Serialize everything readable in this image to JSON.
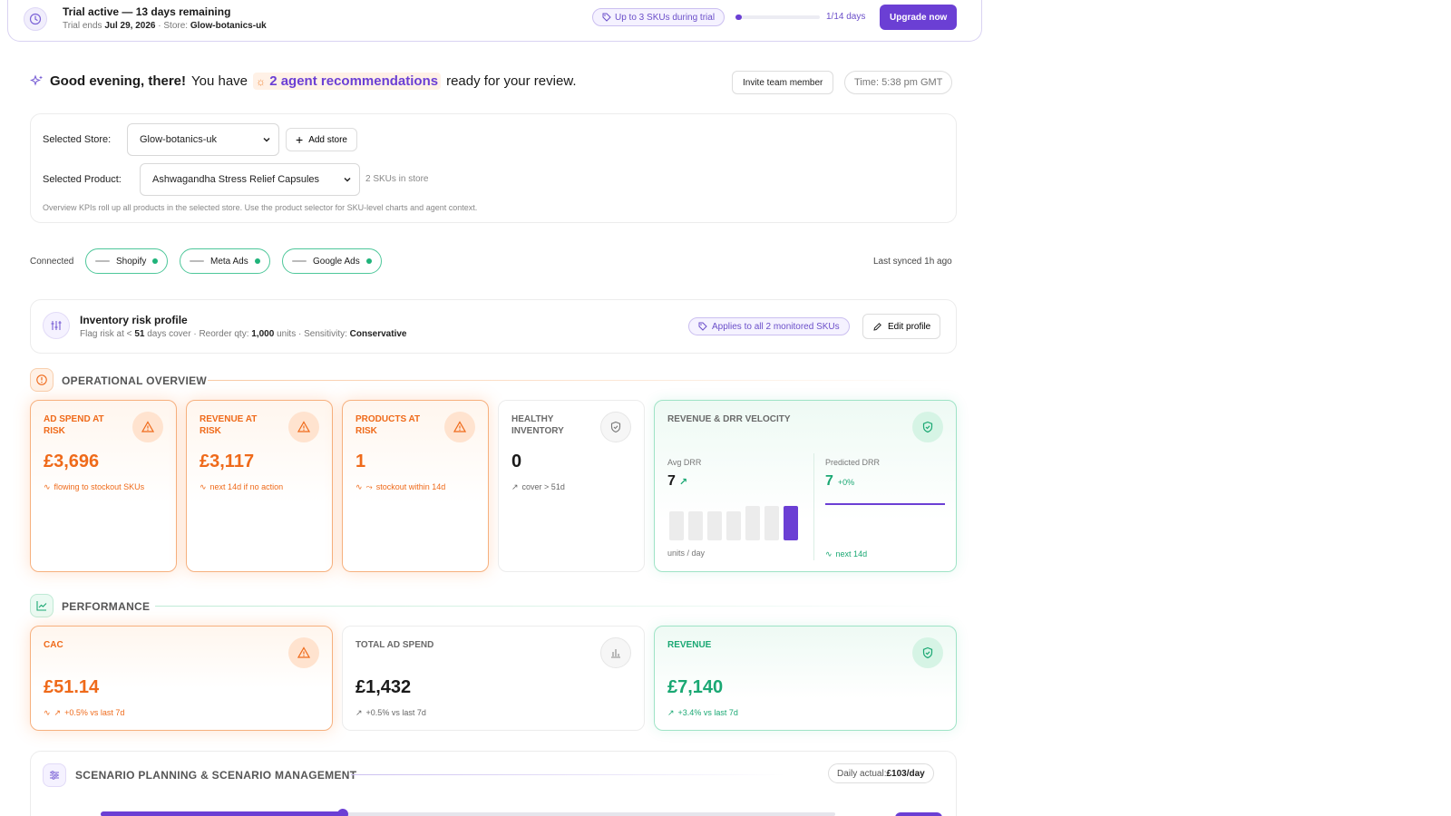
{
  "trial": {
    "title": "Trial active — 13 days remaining",
    "ends_prefix": "Trial ends ",
    "ends_date": "Jul 29, 2026",
    "store_prefix": " · Store: ",
    "store": "Glow-botanics-uk",
    "sku_limit": "Up to 3 SKUs during trial",
    "progress": 0.0714,
    "days": "1/14 days",
    "upgrade": "Upgrade now"
  },
  "greeting": {
    "hello": "Good evening, there!",
    "you_have": "You have",
    "recommendations": "2 agent recommendations",
    "ready": "ready for your review.",
    "invite": "Invite team member",
    "time": "Time: 5:38 pm GMT"
  },
  "selectors": {
    "store_label": "Selected Store:",
    "store_value": "Glow-botanics-uk",
    "add_store": "Add store",
    "product_label": "Selected Product:",
    "product_value": "Ashwagandha Stress Relief Capsules",
    "sku_note": "2 SKUs in store",
    "kpi_note": "Overview KPIs roll up all products in the selected store. Use the product selector for SKU-level charts and agent context."
  },
  "connected": {
    "label": "Connected",
    "items": [
      "Shopify",
      "Meta Ads",
      "Google Ads"
    ],
    "synced": "Last synced 1h ago"
  },
  "risk_profile": {
    "title": "Inventory risk profile",
    "flag_prefix": "Flag risk at < ",
    "flag_days": "51",
    "flag_suffix": " days cover · Reorder qty: ",
    "reorder": "1,000",
    "units_suffix": " units · Sensitivity: ",
    "sensitivity": "Conservative",
    "applies": "Applies to all 2 monitored SKUs",
    "edit": "Edit profile"
  },
  "operational": {
    "title": "OPERATIONAL OVERVIEW",
    "cards": [
      {
        "label": "AD SPEND AT RISK",
        "value": "£3,696",
        "foot": "flowing to stockout SKUs"
      },
      {
        "label": "REVENUE AT RISK",
        "value": "£3,117",
        "foot": "next 14d if no action"
      },
      {
        "label": "PRODUCTS AT RISK",
        "value": "1",
        "foot": "stockout within 14d"
      },
      {
        "label": "HEALTHY INVENTORY",
        "value": "0",
        "foot": "cover > 51d"
      }
    ],
    "velocity": {
      "title": "REVENUE & DRR VELOCITY",
      "avg_label": "Avg DRR",
      "avg_value": "7",
      "avg_units": "units / day",
      "bars": [
        0.45,
        0.45,
        0.45,
        0.45,
        0.52,
        0.52,
        0.52
      ],
      "pred_label": "Predicted DRR",
      "pred_value": "7",
      "pred_change": "+0%",
      "pred_foot": "next 14d"
    }
  },
  "performance": {
    "title": "PERFORMANCE",
    "cards": [
      {
        "label": "CAC",
        "value": "£51.14",
        "foot": "+0.5% vs last 7d"
      },
      {
        "label": "TOTAL AD SPEND",
        "value": "£1,432",
        "foot": "+0.5% vs last 7d"
      },
      {
        "label": "REVENUE",
        "value": "£7,140",
        "foot": "+3.4% vs last 7d"
      }
    ]
  },
  "scenario": {
    "title": "SCENARIO PLANNING & SCENARIO MANAGEMENT",
    "daily_prefix": "Daily actual: ",
    "daily_value": "£103/day",
    "slider": 0.33
  },
  "colors": {
    "accent": "#6b3fd4",
    "warning": "#ef6a1a",
    "success": "#1aa873"
  }
}
